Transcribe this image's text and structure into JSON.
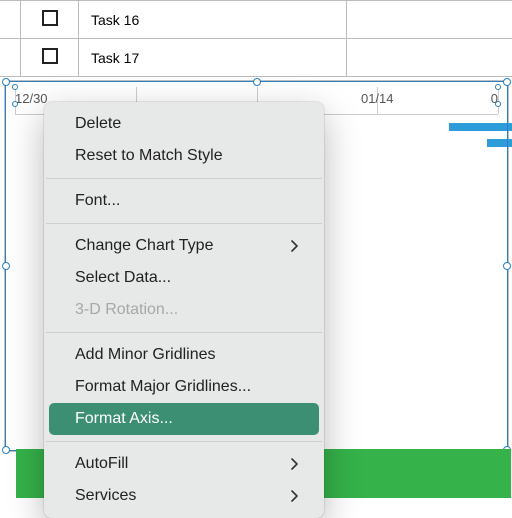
{
  "tasks": {
    "rows": [
      {
        "name": "Task 16"
      },
      {
        "name": "Task 17"
      }
    ]
  },
  "axis": {
    "labels": {
      "t0": "12/30",
      "t3": "01/14",
      "t4": "0"
    }
  },
  "menu": {
    "delete": "Delete",
    "reset": "Reset to Match Style",
    "font": "Font...",
    "change_type": "Change Chart Type",
    "select_data": "Select Data...",
    "rotation": "3-D Rotation...",
    "add_minor": "Add Minor Gridlines",
    "format_major": "Format Major Gridlines...",
    "format_axis": "Format Axis...",
    "autofill": "AutoFill",
    "services": "Services"
  },
  "colors": {
    "accent": "#3c8f72",
    "bar": "#2d9cdb",
    "green_band": "#35b24a"
  }
}
